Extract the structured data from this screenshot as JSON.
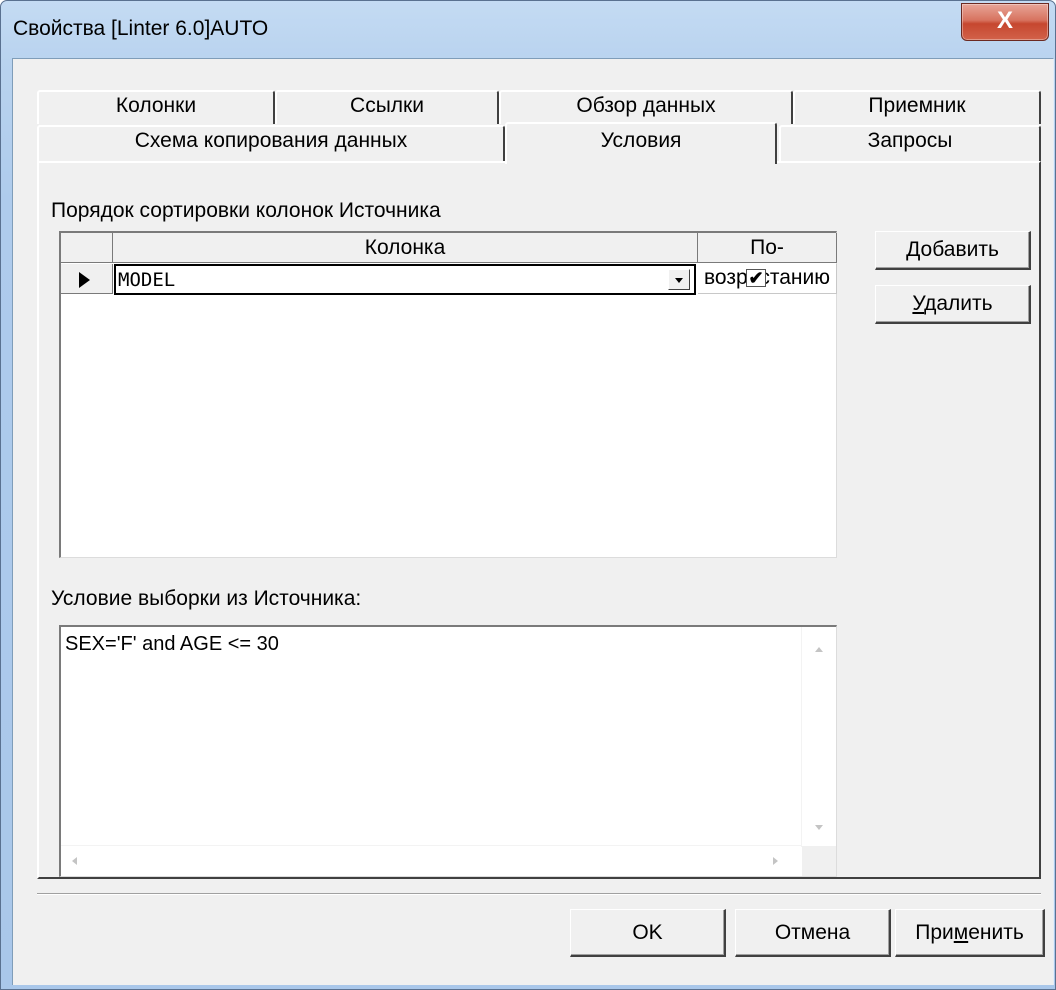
{
  "window": {
    "title": "Свойства [Linter 6.0]AUTO",
    "close_label": "X"
  },
  "tabs_row1": [
    {
      "label": "Колонки"
    },
    {
      "label": "Ссылки"
    },
    {
      "label": "Обзор данных"
    },
    {
      "label": "Приемник"
    }
  ],
  "tabs_row2": [
    {
      "label": "Схема копирования данных"
    },
    {
      "label": "Условия",
      "active": true
    },
    {
      "label": "Запросы"
    }
  ],
  "sort": {
    "label": "Порядок сортировки колонок Источника",
    "headers": {
      "column": "Колонка",
      "ascending": "По-возрастанию"
    },
    "rows": [
      {
        "column": "MODEL",
        "ascending": true,
        "check_glyph": "✔"
      }
    ],
    "add_button": {
      "prefix": "",
      "mnemonic": "Д",
      "rest": "обавить"
    },
    "delete_button": {
      "prefix": "",
      "mnemonic": "У",
      "rest": "далить"
    }
  },
  "filter": {
    "label": "Условие выборки из Источника:",
    "value": "SEX='F' and AGE <= 30"
  },
  "footer": {
    "ok": "OK",
    "cancel": "Отмена",
    "apply": {
      "prefix": "При",
      "mnemonic": "м",
      "rest": "енить"
    }
  },
  "colors": {
    "title_gradient": "#b9d3ef",
    "close_button": "#c6472f",
    "face": "#f0f0f0"
  }
}
